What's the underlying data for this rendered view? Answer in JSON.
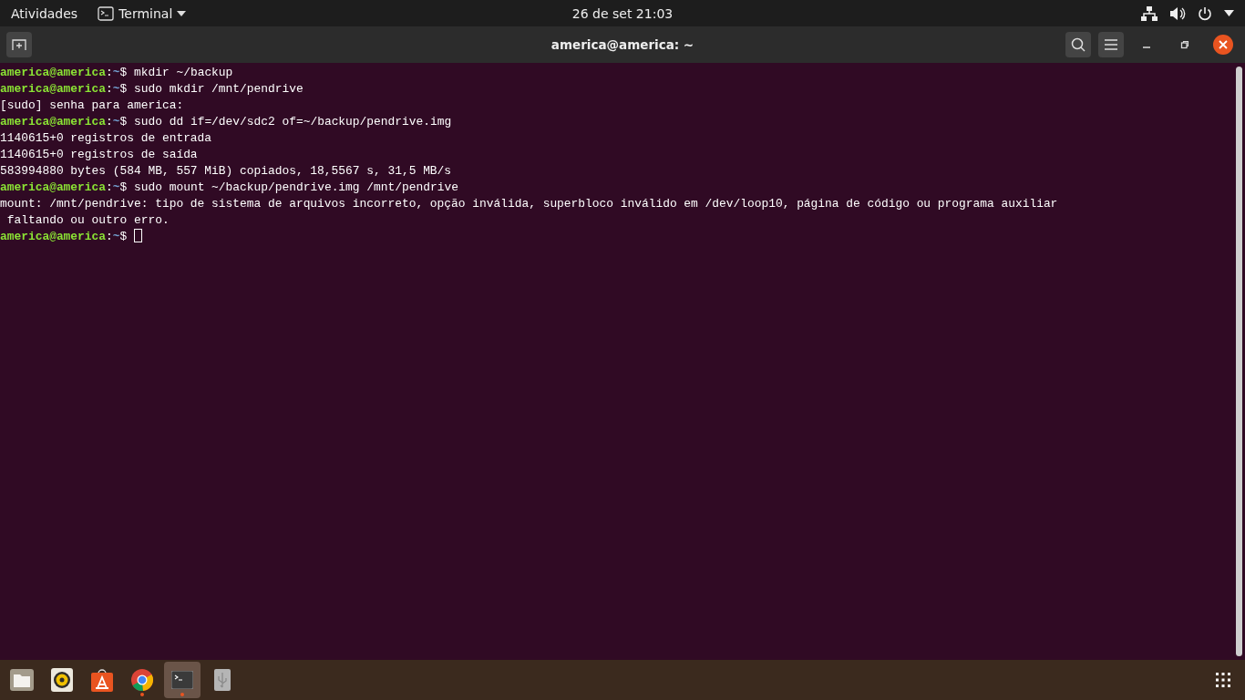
{
  "top_bar": {
    "activities": "Atividades",
    "app_menu": "Terminal",
    "clock": "26 de set  21:03"
  },
  "window": {
    "title": "america@america: ~"
  },
  "terminal": {
    "lines": [
      {
        "kind": "prompt",
        "user": "america@america",
        "separator": ":",
        "path": "~",
        "symbol": "$",
        "command": " mkdir ~/backup"
      },
      {
        "kind": "prompt",
        "user": "america@america",
        "separator": ":",
        "path": "~",
        "symbol": "$",
        "command": " sudo mkdir /mnt/pendrive"
      },
      {
        "kind": "output",
        "text": "[sudo] senha para america:"
      },
      {
        "kind": "prompt",
        "user": "america@america",
        "separator": ":",
        "path": "~",
        "symbol": "$",
        "command": " sudo dd if=/dev/sdc2 of=~/backup/pendrive.img"
      },
      {
        "kind": "output",
        "text": "1140615+0 registros de entrada"
      },
      {
        "kind": "output",
        "text": "1140615+0 registros de saída"
      },
      {
        "kind": "output",
        "text": "583994880 bytes (584 MB, 557 MiB) copiados, 18,5567 s, 31,5 MB/s"
      },
      {
        "kind": "prompt",
        "user": "america@america",
        "separator": ":",
        "path": "~",
        "symbol": "$",
        "command": " sudo mount ~/backup/pendrive.img /mnt/pendrive"
      },
      {
        "kind": "output",
        "text": "mount: /mnt/pendrive: tipo de sistema de arquivos incorreto, opção inválida, superbloco inválido em /dev/loop10, página de código ou programa auxiliar"
      },
      {
        "kind": "output",
        "text": " faltando ou outro erro."
      },
      {
        "kind": "prompt",
        "user": "america@america",
        "separator": ":",
        "path": "~",
        "symbol": "$",
        "cursor": true
      }
    ]
  },
  "dock": {
    "items": [
      {
        "kind": "files",
        "running": false,
        "selected": false
      },
      {
        "kind": "music",
        "running": false,
        "selected": false
      },
      {
        "kind": "software",
        "running": false,
        "selected": false
      },
      {
        "kind": "browser",
        "running": true,
        "selected": false
      },
      {
        "kind": "terminal",
        "running": true,
        "selected": true
      },
      {
        "kind": "usb",
        "running": false,
        "selected": false
      }
    ]
  }
}
